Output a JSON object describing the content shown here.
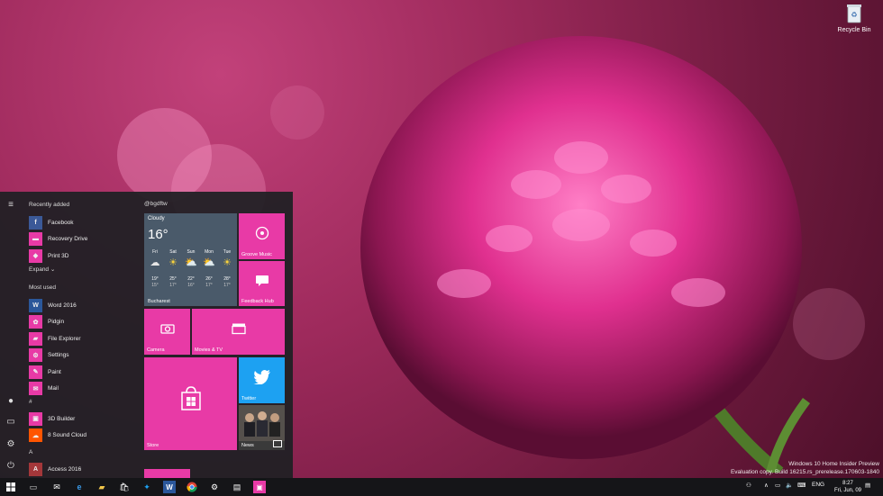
{
  "desktop": {
    "recycle_bin_label": "Recycle Bin",
    "watermark_line1": "Windows 10 Home Insider Preview",
    "watermark_line2": "Evaluation copy. Build 16215.rs_prerelease.170603-1840"
  },
  "start_menu": {
    "recently_added_header": "Recently added",
    "recently_added": [
      {
        "label": "Facebook",
        "icon": "facebook-icon",
        "color": "#3b5998",
        "glyph": "f"
      },
      {
        "label": "Recovery Drive",
        "icon": "recovery-drive-icon",
        "color": "#e83aa6",
        "glyph": "▬"
      },
      {
        "label": "Print 3D",
        "icon": "print-3d-icon",
        "color": "#e83aa6",
        "glyph": "◆"
      }
    ],
    "expand_label": "Expand",
    "most_used_header": "Most used",
    "most_used": [
      {
        "label": "Word 2016",
        "icon": "word-icon",
        "color": "#2b579a",
        "glyph": "W"
      },
      {
        "label": "Pidgin",
        "icon": "pidgin-icon",
        "color": "#e83aa6",
        "glyph": "✿"
      },
      {
        "label": "File Explorer",
        "icon": "file-explorer-icon",
        "color": "#e83aa6",
        "glyph": "▰"
      },
      {
        "label": "Settings",
        "icon": "settings-icon",
        "color": "#e83aa6",
        "glyph": "⚙"
      },
      {
        "label": "Paint",
        "icon": "paint-icon",
        "color": "#e83aa6",
        "glyph": "✎"
      },
      {
        "label": "Mail",
        "icon": "mail-icon",
        "color": "#e83aa6",
        "glyph": "✉"
      }
    ],
    "hash_header": "#",
    "hash_apps": [
      {
        "label": "3D Builder",
        "icon": "3d-builder-icon",
        "color": "#e83aa6",
        "glyph": "▣"
      },
      {
        "label": "8 Sound Cloud",
        "icon": "soundcloud-icon",
        "color": "#ff5500",
        "glyph": "☁"
      }
    ],
    "a_header": "A",
    "a_apps": [
      {
        "label": "Access 2016",
        "icon": "access-icon",
        "color": "#a4373a",
        "glyph": "A"
      }
    ],
    "tiles_group_title": "@bgdftw",
    "weather": {
      "condition": "Cloudy",
      "temp": "16°",
      "city": "Bucharest",
      "days": [
        {
          "day": "Fri",
          "icon": "cloud-rain-icon",
          "glyph": "☁",
          "hi": "19°",
          "lo": "15°"
        },
        {
          "day": "Sat",
          "icon": "sun-icon",
          "glyph": "☀",
          "hi": "25°",
          "lo": "17°"
        },
        {
          "day": "Sun",
          "icon": "partly-cloudy-icon",
          "glyph": "⛅",
          "hi": "22°",
          "lo": "16°"
        },
        {
          "day": "Mon",
          "icon": "partly-cloudy-icon",
          "glyph": "⛅",
          "hi": "26°",
          "lo": "17°"
        },
        {
          "day": "Tue",
          "icon": "sun-icon",
          "glyph": "☀",
          "hi": "28°",
          "lo": "17°"
        }
      ]
    },
    "tiles": {
      "groove": "Groove Music",
      "feedback": "Feedback Hub",
      "camera": "Camera",
      "movies": "Movies & TV",
      "store": "Store",
      "twitter": "Twitter",
      "news": "News"
    }
  },
  "taskbar": {
    "language": "ENG",
    "time": "8:27",
    "date": "Fri, Jun, 09"
  },
  "colors": {
    "accent": "#e83aa6",
    "taskbar": "#151518",
    "start_bg": "#202024"
  }
}
